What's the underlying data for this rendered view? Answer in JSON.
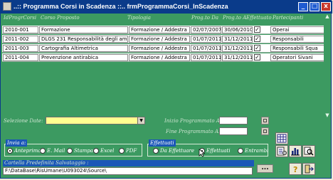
{
  "window": {
    "title": "..:: Programma Corsi in Scadenza ::..    frmProgrammaCorsi_InScadenza",
    "buttons": [
      "_",
      "□",
      "x"
    ]
  },
  "table": {
    "columns": [
      "IdProgrCorsi",
      "Corso Proposto",
      "Tipologia",
      "Prog.to Da",
      "Prog.to A",
      "Effettuato",
      "Partecipanti"
    ],
    "rows": [
      {
        "id": "2010-001",
        "corso": "Formazione",
        "tipologia": "Formazione / Addestra",
        "da": "02/07/2007",
        "a": "30/06/2010",
        "effettuato": "✓",
        "partecipanti": "Operai"
      },
      {
        "id": "2011-002",
        "corso": "DLGS 231  Responsabilità degli ammini",
        "tipologia": "Formazione / Addestra",
        "da": "01/07/2011",
        "a": "31/12/2011",
        "effettuato": "✓",
        "partecipanti": "Responsabili"
      },
      {
        "id": "2011-003",
        "corso": "Cartografia Altimetrica",
        "tipologia": "Formazione / Addestra",
        "da": "01/07/2011",
        "a": "31/12/2011",
        "effettuato": "✓",
        "partecipanti": "Responsabili Squa"
      },
      {
        "id": "2011-004",
        "corso": "Prevenzione antirabica",
        "tipologia": "Formazione / Addestra",
        "da": "01/07/2011",
        "a": "31/12/2011",
        "effettuato": "✓",
        "partecipanti": "Operatori Sivani"
      }
    ]
  },
  "filters": {
    "selection_label": "Selezione Date:",
    "inizio_label": "Inizio Programmato A:",
    "fine_label": "Fine Programmato A:"
  },
  "invio": {
    "title": "Invia a:",
    "options": [
      "Anteprima",
      "E. Mail",
      "Stampa",
      "Excel",
      "PDF"
    ],
    "selected": "Anteprima"
  },
  "effettuati": {
    "title": "Effettuati",
    "options": [
      "Da Effettuare",
      "Effettuati",
      "Entrambi"
    ],
    "selected": "Effettuati"
  },
  "path": {
    "label": "Cartella Predefinita Salvataggio :",
    "value": "F:\\DataBase\\RisUmane\\U093024\\Source\\",
    "browse_label": "..."
  },
  "colors": {
    "background": "#3c9a61",
    "title_bar": "#0a3b8a",
    "group_title": "#1b57b7",
    "select_field": "#ffff90"
  }
}
